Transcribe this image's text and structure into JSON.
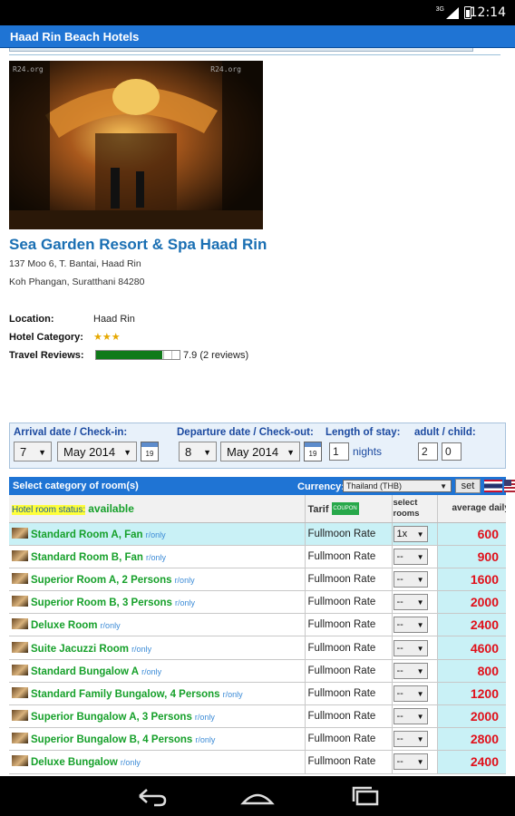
{
  "status_bar": {
    "network": "3G",
    "time": "12:14"
  },
  "app": {
    "title": "Haad Rin Beach Hotels"
  },
  "photo": {
    "watermark_left": "R24.org",
    "watermark_right": "R24.org"
  },
  "hotel": {
    "name": "Sea Garden Resort & Spa Haad Rin",
    "address_line1": "137 Moo 6, T. Bantai, Haad Rin",
    "address_line2": "Koh Phangan, Suratthani 84280",
    "location_label": "Location:",
    "location_value": "Haad Rin",
    "category_label": "Hotel Category:",
    "category_stars": "★★★",
    "category_star_count": 3,
    "reviews_label": "Travel Reviews:",
    "reviews_text": "7.9 (2 reviews)",
    "review_score_fraction": 0.79
  },
  "booking": {
    "arrival_label": "Arrival date / Check-in:",
    "arrival_day": "7",
    "arrival_month": "May 2014",
    "departure_label": "Departure date / Check-out:",
    "departure_day": "8",
    "departure_month": "May 2014",
    "stay_label": "Length of stay:",
    "stay_value": "1",
    "nights_label": "nights",
    "guests_label": "adult / child:",
    "adults": "2",
    "children": "0",
    "calendar_icon_text": "19"
  },
  "rooms_header": {
    "title": "Select category of room(s)",
    "currency_label": "Currency:",
    "currency_value": "Thailand (THB)",
    "set_label": "set"
  },
  "table_header": {
    "status_label": "Hotel room status:",
    "status_value": "available",
    "tarif": "Tarif",
    "coupon": "COUPON",
    "select_rooms_1": "select",
    "select_rooms_2": "rooms",
    "average": "average daily"
  },
  "rooms": [
    {
      "name": "Standard Room A, Fan",
      "tag": "r/only",
      "tarif": "Fullmoon Rate",
      "qty": "1x",
      "price": "600"
    },
    {
      "name": "Standard Room B, Fan",
      "tag": "r/only",
      "tarif": "Fullmoon Rate",
      "qty": "--",
      "price": "900"
    },
    {
      "name": "Superior Room A, 2 Persons",
      "tag": "r/only",
      "tarif": "Fullmoon Rate",
      "qty": "--",
      "price": "1600"
    },
    {
      "name": "Superior Room B, 3 Persons",
      "tag": "r/only",
      "tarif": "Fullmoon Rate",
      "qty": "--",
      "price": "2000"
    },
    {
      "name": "Deluxe Room",
      "tag": "r/only",
      "tarif": "Fullmoon Rate",
      "qty": "--",
      "price": "2400"
    },
    {
      "name": "Suite Jacuzzi Room",
      "tag": "r/only",
      "tarif": "Fullmoon Rate",
      "qty": "--",
      "price": "4600"
    },
    {
      "name": "Standard Bungalow A",
      "tag": "r/only",
      "tarif": "Fullmoon Rate",
      "qty": "--",
      "price": "800"
    },
    {
      "name": "Standard Family Bungalow, 4 Persons",
      "tag": "r/only",
      "tarif": "Fullmoon Rate",
      "qty": "--",
      "price": "1200"
    },
    {
      "name": "Superior Bungalow A, 3 Persons",
      "tag": "r/only",
      "tarif": "Fullmoon Rate",
      "qty": "--",
      "price": "2000"
    },
    {
      "name": "Superior Bungalow B, 4 Persons",
      "tag": "r/only",
      "tarif": "Fullmoon Rate",
      "qty": "--",
      "price": "2800"
    },
    {
      "name": "Deluxe Bungalow",
      "tag": "r/only",
      "tarif": "Fullmoon Rate",
      "qty": "--",
      "price": "2400"
    }
  ],
  "colors": {
    "appbar": "#1f74d4",
    "room_name": "#16a02a",
    "price": "#e0101a",
    "highlight": "#c9f1f6"
  }
}
